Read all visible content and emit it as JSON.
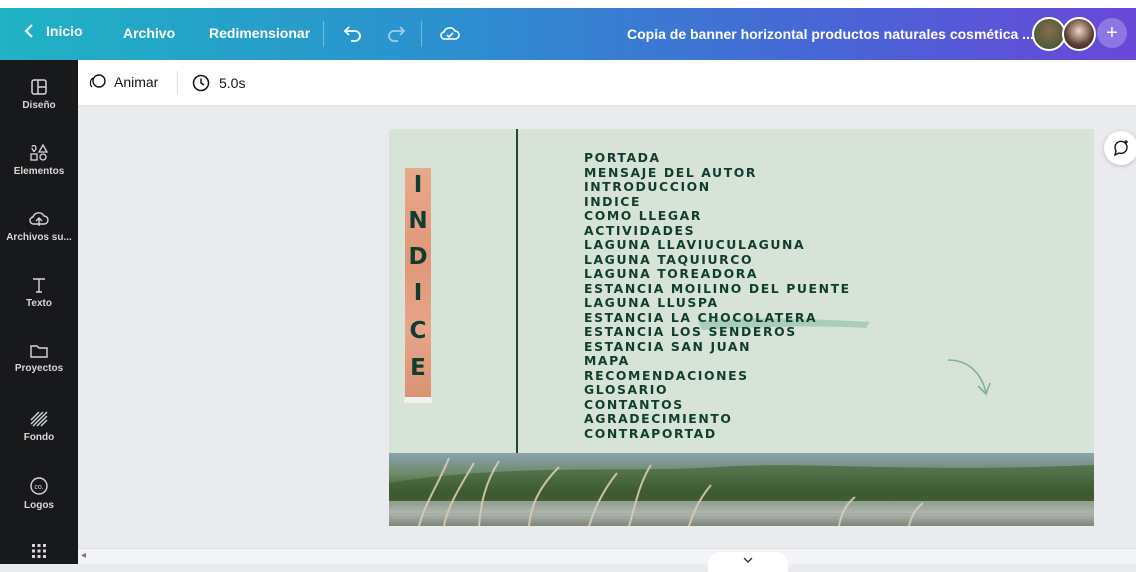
{
  "topbar": {
    "back_label": "Inicio",
    "file_label": "Archivo",
    "resize_label": "Redimensionar",
    "document_title": "Copia de banner horizontal productos naturales cosmética ..."
  },
  "sidebar": {
    "items": [
      {
        "label": "Diseño",
        "icon": "layout-icon"
      },
      {
        "label": "Elementos",
        "icon": "shapes-icon"
      },
      {
        "label": "Archivos su...",
        "icon": "cloud-upload-icon"
      },
      {
        "label": "Texto",
        "icon": "text-icon"
      },
      {
        "label": "Proyectos",
        "icon": "folder-icon"
      },
      {
        "label": "Fondo",
        "icon": "pattern-icon"
      },
      {
        "label": "Logos",
        "icon": "logo-icon"
      },
      {
        "label": "",
        "icon": "apps-grid-icon"
      }
    ]
  },
  "toolbar": {
    "animate_label": "Animar",
    "duration_label": "5.0s"
  },
  "canvas": {
    "vertical_letters": [
      "I",
      "N",
      "D",
      "I",
      "C",
      "E"
    ],
    "index_items": [
      "PORTADA",
      "MENSAJE DEL AUTOR",
      "INTRODUCCION",
      "INDICE",
      "COMO LLEGAR",
      "ACTIVIDADES",
      "LAGUNA LLAVIUCULAGUNA",
      "LAGUNA TAQUIURCO",
      "LAGUNA TOREADORA",
      "ESTANCIA MOILINO DEL PUENTE",
      "LAGUNA LLUSPA",
      "ESTANCIA LA CHOCOLATERA",
      "ESTANCIA LOS SENDEROS",
      "ESTANCIA SAN JUAN",
      "MAPA",
      "RECOMENDACIONES",
      "GLOSARIO",
      "CONTANTOS",
      "AGRADECIMIENTO",
      "CONTRAPORTAD"
    ]
  },
  "colors": {
    "canvas_bg": "#d6e3d6",
    "text_dark_green": "#0f3d2f",
    "ribbon": "#e0977a",
    "sidebar_bg": "#18191b"
  }
}
